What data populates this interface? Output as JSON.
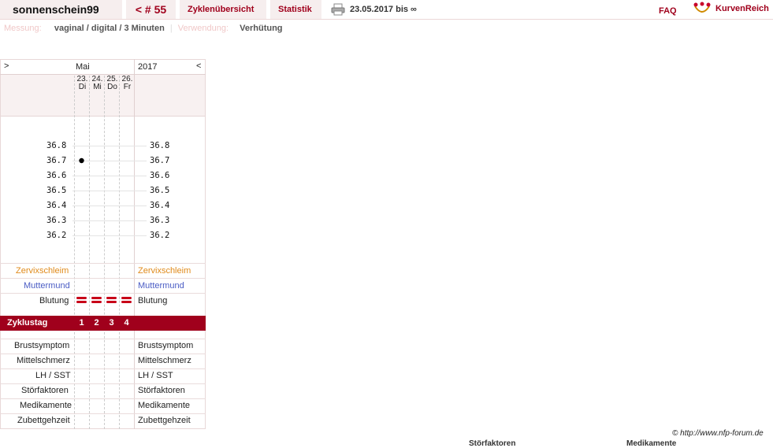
{
  "header": {
    "username": "sonnenschein99",
    "cycle_label": "< # 55",
    "tab_overview": "Zyklenübersicht",
    "tab_stats": "Statistik",
    "date_range": "23.05.2017 bis ∞",
    "faq": "FAQ",
    "brand": "KurvenReich"
  },
  "measurement": {
    "label": "Messung:",
    "value": "vaginal / digital / 3 Minuten",
    "sep": "|",
    "usage_label": "Verwendung:",
    "usage_value": "Verhütung"
  },
  "chart": {
    "nav_prev": ">",
    "nav_next": "<",
    "month": "Mai",
    "year": "2017",
    "days": [
      {
        "num": "23.",
        "dow": "Di"
      },
      {
        "num": "24.",
        "dow": "Mi"
      },
      {
        "num": "25.",
        "dow": "Do"
      },
      {
        "num": "26.",
        "dow": "Fr"
      }
    ],
    "temp_labels": [
      "36.8",
      "36.7",
      "36.6",
      "36.5",
      "36.4",
      "36.3",
      "36.2"
    ],
    "rows": {
      "zervix": "Zervixschleim",
      "muttermund": "Muttermund",
      "blutung": "Blutung",
      "zyklustag": "Zyklustag",
      "brust": "Brustsymptom",
      "mittel": "Mittelschmerz",
      "lh": "LH / SST",
      "stoer": "Störfaktoren",
      "medi": "Medikamente",
      "zubett": "Zubettgehzeit"
    },
    "cycle_days": [
      "1",
      "2",
      "3",
      "4"
    ]
  },
  "chart_data": {
    "type": "scatter",
    "x": [
      "23.",
      "24.",
      "25.",
      "26."
    ],
    "series": [
      {
        "values": [
          36.7,
          null,
          null,
          null
        ]
      }
    ],
    "ylim": [
      36.2,
      36.8
    ]
  },
  "footer": {
    "copyright": "© http://www.nfp-forum.de",
    "cut1": "Störfaktoren",
    "cut2": "Medikamente"
  },
  "colors": {
    "accent": "#a0001c",
    "zervix": "#e08a1a",
    "muttermund": "#4a5cc4",
    "bleed": "#c80018"
  }
}
